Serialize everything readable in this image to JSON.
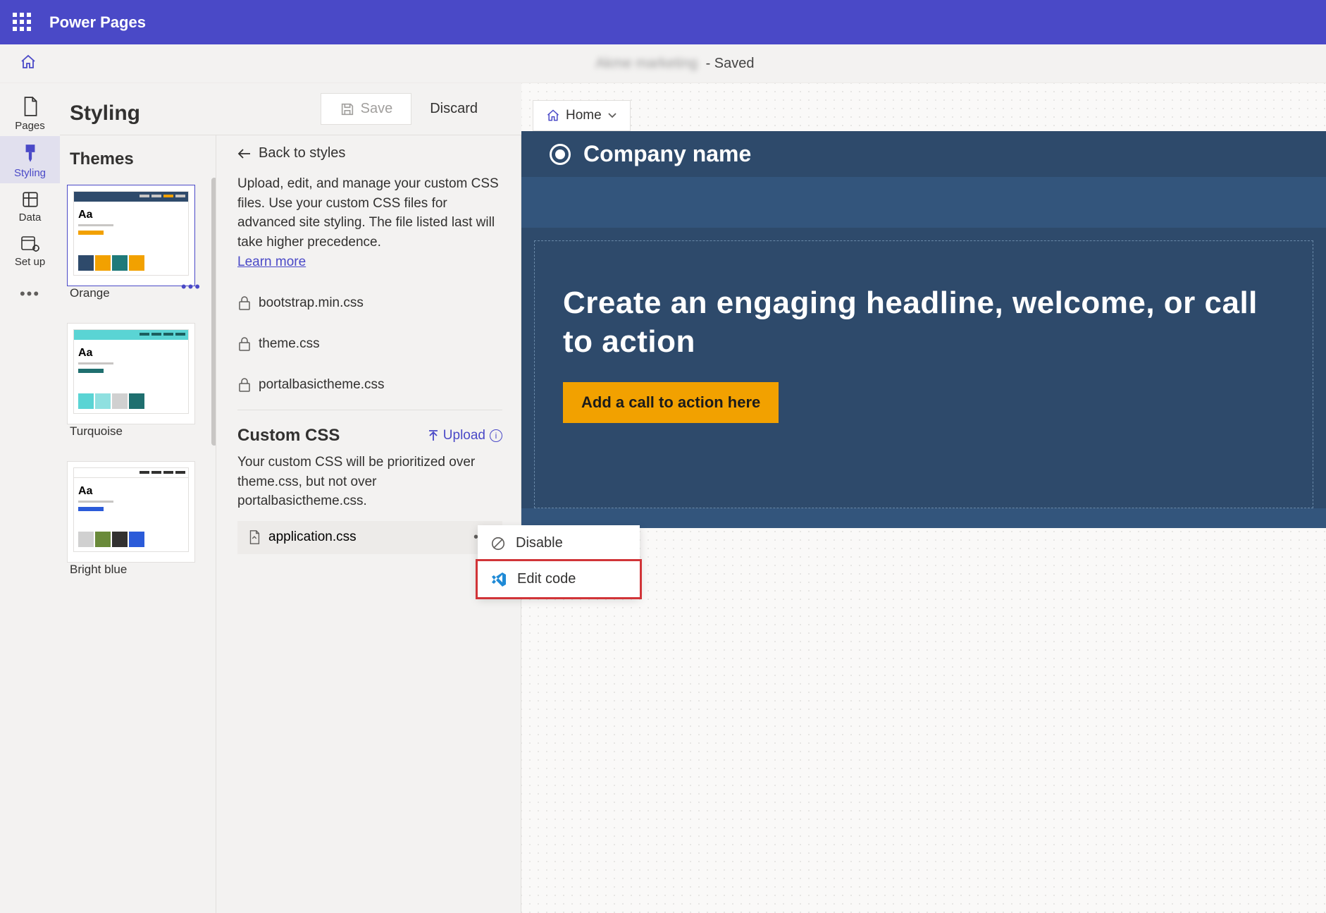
{
  "topbar": {
    "title": "Power Pages"
  },
  "secondbar": {
    "site_blurred": "Akme marketing",
    "status": "- Saved"
  },
  "rail": {
    "items": [
      {
        "label": "Pages"
      },
      {
        "label": "Styling"
      },
      {
        "label": "Data"
      },
      {
        "label": "Set up"
      }
    ]
  },
  "styling": {
    "heading": "Styling",
    "toolbar": {
      "save": "Save",
      "discard": "Discard"
    },
    "themes_title": "Themes",
    "themes": [
      {
        "name": "Orange"
      },
      {
        "name": "Turquoise"
      },
      {
        "name": "Bright blue"
      }
    ]
  },
  "detail": {
    "back": "Back to styles",
    "desc": "Upload, edit, and manage your custom CSS files. Use your custom CSS files for advanced site styling. The file listed last will take higher precedence.",
    "learn": "Learn more",
    "locked_files": [
      "bootstrap.min.css",
      "theme.css",
      "portalbasictheme.css"
    ],
    "custom_heading": "Custom CSS",
    "upload_label": "Upload",
    "custom_desc": "Your custom CSS will be prioritized over theme.css, but not over portalbasictheme.css.",
    "custom_file": "application.css",
    "ctx_menu": {
      "disable": "Disable",
      "edit_code": "Edit code"
    }
  },
  "preview": {
    "crumb": "Home",
    "company": "Company name",
    "headline": "Create an engaging headline, welcome, or call to action",
    "cta": "Add a call to action here"
  }
}
